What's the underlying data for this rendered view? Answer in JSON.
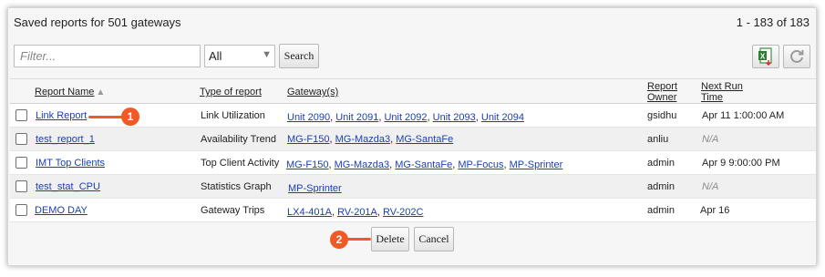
{
  "header": {
    "title": "Saved reports for 501 gateways",
    "count": "1 - 183 of 183"
  },
  "toolbar": {
    "filter_placeholder": "Filter...",
    "filter_value": "",
    "type_select_value": "All",
    "search_label": "Search",
    "excel_icon": "excel-export-icon",
    "refresh_icon": "refresh-icon"
  },
  "table": {
    "columns": {
      "name": "Report Name",
      "type": "Type of report",
      "gateways": "Gateway(s)",
      "owner_line1": "Report",
      "owner_line2": "Owner",
      "next_line1": "Next Run",
      "next_line2": "Time"
    },
    "rows": [
      {
        "name": "Link Report",
        "type": "Link Utilization",
        "gateways": [
          "Unit 2090",
          "Unit 2091",
          "Unit 2092",
          "Unit 2093",
          "Unit 2094"
        ],
        "owner": "gsidhu",
        "next_run": "Apr 11 1:00:00 AM"
      },
      {
        "name": "test_report_1",
        "type": "Availability Trend",
        "gateways": [
          "MG-F150",
          "MG-Mazda3",
          "MG-SantaFe"
        ],
        "owner": "anliu",
        "next_run": "N/A"
      },
      {
        "name": "IMT Top Clients",
        "type": "Top Client Activity",
        "gateways": [
          "MG-F150",
          "MG-Mazda3",
          "MG-SantaFe",
          "MP-Focus",
          "MP-Sprinter"
        ],
        "owner": "admin",
        "next_run": "Apr 9 9:00:00 PM"
      },
      {
        "name": "test_stat_CPU",
        "type": "Statistics Graph",
        "gateways": [
          "MP-Sprinter"
        ],
        "owner": "admin",
        "next_run": "N/A"
      },
      {
        "name": "DEMO DAY",
        "type": "Gateway Trips",
        "gateways": [
          "LX4-401A",
          "RV-201A",
          "RV-202C"
        ],
        "owner": "admin",
        "next_run": "Apr 16"
      }
    ]
  },
  "actions": {
    "delete_label": "Delete",
    "cancel_label": "Cancel"
  },
  "callouts": {
    "first": "1",
    "second": "2",
    "color": "#f15a24"
  }
}
